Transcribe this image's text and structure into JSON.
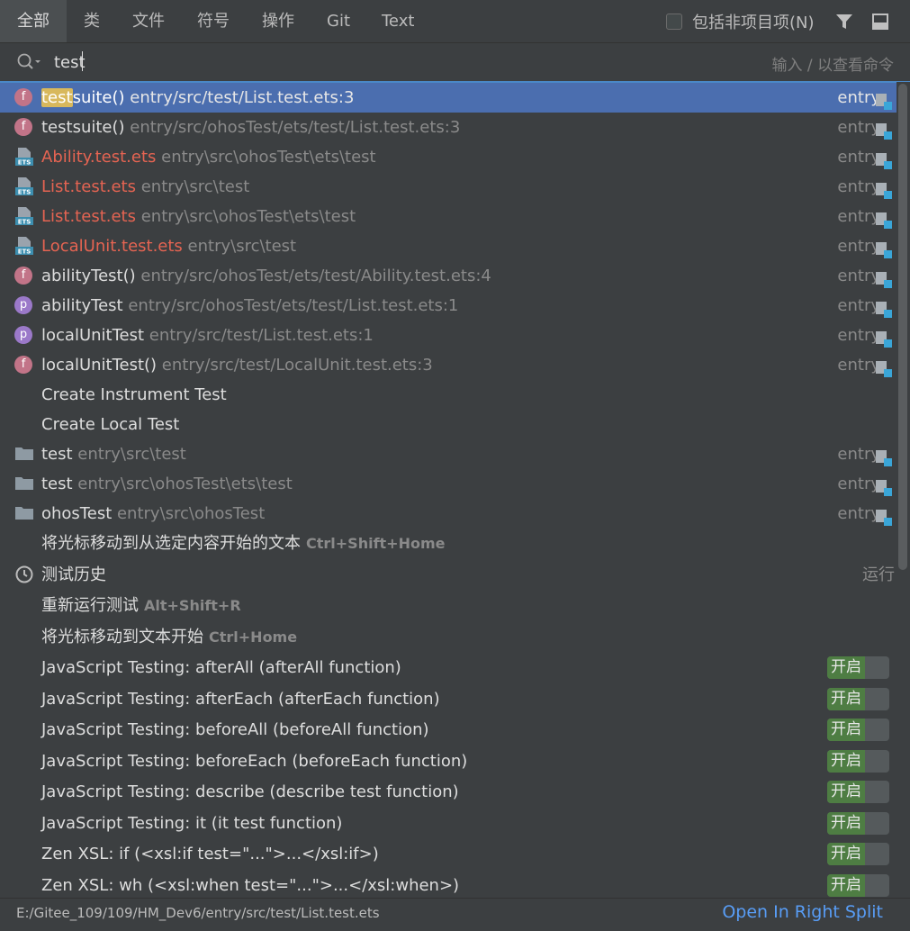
{
  "tabs": [
    {
      "label": "全部",
      "active": true
    },
    {
      "label": "类"
    },
    {
      "label": "文件"
    },
    {
      "label": "符号"
    },
    {
      "label": "操作"
    },
    {
      "label": "Git"
    },
    {
      "label": "Text"
    }
  ],
  "header": {
    "non_project_label": "包括非项目项(N)",
    "filter_icon": "filter-icon",
    "preview_icon": "preview-panel-icon"
  },
  "search": {
    "value": "test",
    "hint": "输入 / 以查看命令",
    "icon": "search-icon"
  },
  "rows": [
    {
      "icon": "f",
      "name_highlight": "test",
      "name": "suite()",
      "path": " entry/src/test/List.test.ets:3",
      "right": "entry",
      "selected": true
    },
    {
      "icon": "f",
      "name": "testsuite()",
      "path": " entry/src/ohosTest/ets/test/List.test.ets:3",
      "right": "entry"
    },
    {
      "icon": "ets",
      "name": "Ability.test.ets",
      "red": true,
      "path": " entry\\src\\ohosTest\\ets\\test",
      "right": "entry"
    },
    {
      "icon": "ets",
      "name": "List.test.ets",
      "red": true,
      "path": " entry\\src\\test",
      "right": "entry"
    },
    {
      "icon": "ets",
      "name": "List.test.ets",
      "red": true,
      "path": " entry\\src\\ohosTest\\ets\\test",
      "right": "entry"
    },
    {
      "icon": "ets",
      "name": "LocalUnit.test.ets",
      "red": true,
      "path": " entry\\src\\test",
      "right": "entry"
    },
    {
      "icon": "f",
      "name": "abilityTest()",
      "path": " entry/src/ohosTest/ets/test/Ability.test.ets:4",
      "right": "entry"
    },
    {
      "icon": "p",
      "name": "abilityTest",
      "path": " entry/src/ohosTest/ets/test/List.test.ets:1",
      "right": "entry"
    },
    {
      "icon": "p",
      "name": "localUnitTest",
      "path": " entry/src/test/List.test.ets:1",
      "right": "entry"
    },
    {
      "icon": "f",
      "name": "localUnitTest()",
      "path": " entry/src/test/LocalUnit.test.ets:3",
      "right": "entry"
    },
    {
      "icon": "none",
      "name": "Create Instrument Test"
    },
    {
      "icon": "none",
      "name": "Create Local Test"
    },
    {
      "icon": "folder",
      "name": "test",
      "path": " entry\\src\\test",
      "right": "entry"
    },
    {
      "icon": "folder",
      "name": "test",
      "path": " entry\\src\\ohosTest\\ets\\test",
      "right": "entry"
    },
    {
      "icon": "folder",
      "name": "ohosTest",
      "path": " entry\\src\\ohosTest",
      "right": "entry"
    },
    {
      "icon": "none",
      "name": "将光标移动到从选定内容开始的文本",
      "shortcut": "Ctrl+Shift+Home"
    },
    {
      "icon": "clock",
      "name": "测试历史",
      "right_plain": "运行"
    },
    {
      "icon": "none",
      "name": "重新运行测试",
      "shortcut": "Alt+Shift+R"
    },
    {
      "icon": "none",
      "name": "将光标移动到文本开始",
      "shortcut": "Ctrl+Home"
    },
    {
      "icon": "none",
      "name": "JavaScript Testing: afterAll (afterAll function)",
      "toggle": "开启"
    },
    {
      "icon": "none",
      "name": "JavaScript Testing: afterEach (afterEach function)",
      "toggle": "开启"
    },
    {
      "icon": "none",
      "name": "JavaScript Testing: beforeAll (beforeAll function)",
      "toggle": "开启"
    },
    {
      "icon": "none",
      "name": "JavaScript Testing: beforeEach (beforeEach function)",
      "toggle": "开启"
    },
    {
      "icon": "none",
      "name": "JavaScript Testing: describe (describe test function)",
      "toggle": "开启"
    },
    {
      "icon": "none",
      "name": "JavaScript Testing: it (it test function)",
      "toggle": "开启"
    },
    {
      "icon": "none",
      "name": "Zen XSL: if (<xsl:if test=\"...\">...</xsl:if>)",
      "toggle": "开启"
    },
    {
      "icon": "none",
      "name": "Zen XSL: wh (<xsl:when test=\"...\">...</xsl:when>)",
      "toggle": "开启"
    }
  ],
  "footer": {
    "path": "E:/Gitee_109/109/HM_Dev6/entry/src/test/List.test.ets",
    "open_right_split": "Open In Right Split"
  },
  "colors": {
    "background": "#3c3f41",
    "selection": "#4b6eaf",
    "file_red": "#e56452",
    "link_blue": "#589df6",
    "toggle_green": "#4e7d43",
    "highlight": "#d8b85c"
  }
}
